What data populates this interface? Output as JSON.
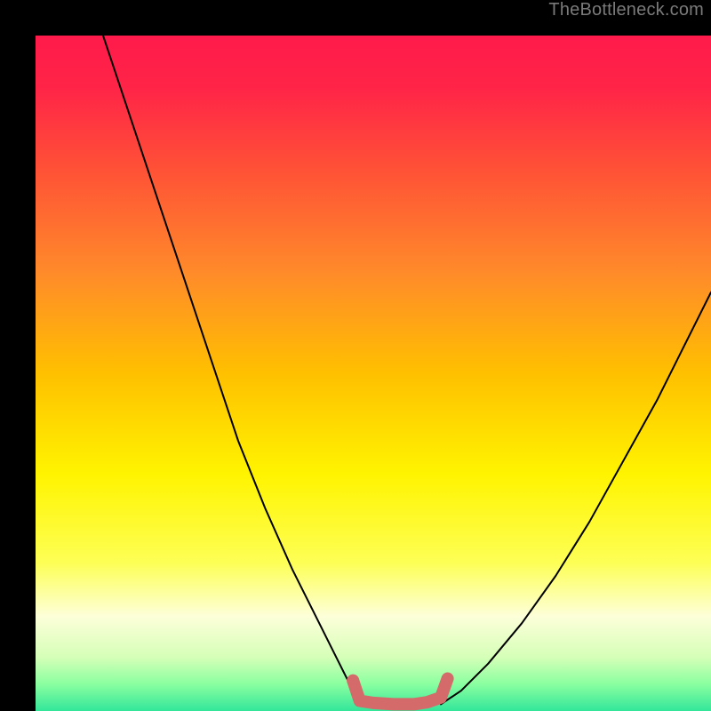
{
  "watermark": {
    "text": "TheBottleneck.com"
  },
  "chart_data": {
    "type": "line",
    "title": "",
    "xlabel": "",
    "ylabel": "",
    "xlim": [
      0,
      100
    ],
    "ylim": [
      0,
      100
    ],
    "grid": false,
    "background_gradient": {
      "stops": [
        {
          "offset": 0.0,
          "color": "#ff1a4b"
        },
        {
          "offset": 0.08,
          "color": "#ff2547"
        },
        {
          "offset": 0.2,
          "color": "#ff5236"
        },
        {
          "offset": 0.35,
          "color": "#ff8a2a"
        },
        {
          "offset": 0.5,
          "color": "#ffc000"
        },
        {
          "offset": 0.65,
          "color": "#fff400"
        },
        {
          "offset": 0.78,
          "color": "#fdff55"
        },
        {
          "offset": 0.86,
          "color": "#fdffd9"
        },
        {
          "offset": 0.92,
          "color": "#d6ffb8"
        },
        {
          "offset": 0.96,
          "color": "#8affa0"
        },
        {
          "offset": 1.0,
          "color": "#33e69a"
        }
      ]
    },
    "series": [
      {
        "name": "left-curve",
        "color": "#000000",
        "stroke_width": 2,
        "x": [
          10,
          14,
          18,
          22,
          26,
          30,
          34,
          38,
          42,
          45,
          47,
          48.5
        ],
        "y": [
          100,
          88,
          76,
          64,
          52,
          40,
          30,
          21,
          13,
          7,
          3,
          1
        ]
      },
      {
        "name": "right-curve",
        "color": "#000000",
        "stroke_width": 2,
        "x": [
          60,
          63,
          67,
          72,
          77,
          82,
          87,
          92,
          96,
          100
        ],
        "y": [
          1,
          3,
          7,
          13,
          20,
          28,
          37,
          46,
          54,
          62
        ]
      },
      {
        "name": "bottom-squiggle",
        "color": "#d46a6a",
        "stroke_width": 14,
        "x": [
          47,
          48,
          50,
          53,
          56,
          58,
          60,
          61
        ],
        "y": [
          4.5,
          1.5,
          1.2,
          1.0,
          1.0,
          1.3,
          2.0,
          4.8
        ]
      }
    ],
    "markers": [
      {
        "name": "left-dot",
        "x": 47.0,
        "y": 4.5,
        "r": 7,
        "color": "#d46a6a"
      }
    ]
  }
}
